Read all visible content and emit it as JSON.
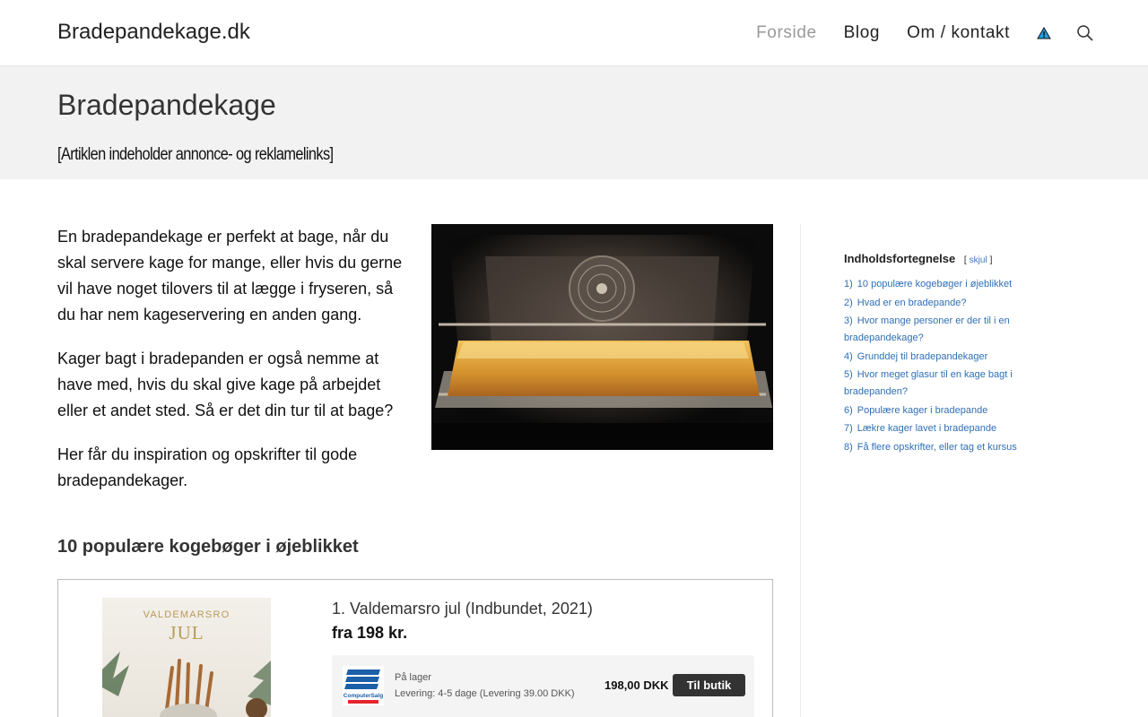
{
  "header": {
    "site_title": "Bradepandekage.dk",
    "nav": [
      {
        "label": "Forside",
        "active": true
      },
      {
        "label": "Blog",
        "active": false
      },
      {
        "label": "Om / kontakt",
        "active": false
      }
    ],
    "flag_icon": "warning-flag-icon",
    "search_icon": "search-icon"
  },
  "title_band": {
    "title": "Bradepandekage",
    "disclaimer": "[Artiklen indeholder annonce- og reklamelinks]"
  },
  "intro": {
    "paragraphs": [
      "En bradepandekage er perfekt at bage, når du skal servere kage for mange, eller hvis du gerne vil have noget tilovers til at lægge i fryseren, så du har nem kageservering en anden gang.",
      "Kager bagt i bradepanden er også nemme at have med, hvis du skal give kage på arbejdet eller et andet sted. Så er det din tur til at bage?",
      "Her får du inspiration og opskrifter til gode bradepandekager."
    ]
  },
  "section": {
    "heading": "10 populære kogebøger i øjeblikket"
  },
  "product": {
    "cover_small": "VALDEMARSRO",
    "cover_big": "JUL",
    "title": "1. Valdemarsro jul (Indbundet, 2021)",
    "price": "fra 198 kr.",
    "offer": {
      "stock": "På lager",
      "delivery": "Levering: 4-5 dage (Levering 39.00 DKK)",
      "price": "198,00 DKK",
      "button": "Til butik",
      "logo_text": "ComputerSalg"
    }
  },
  "toc": {
    "header": "Indholdsfortegnelse",
    "toggle_open": "[",
    "toggle_label": "skjul",
    "toggle_close": "]",
    "items": [
      {
        "num": "1)",
        "label": "10 populære kogebøger i øjeblikket"
      },
      {
        "num": "2)",
        "label": "Hvad er en bradepande?"
      },
      {
        "num": "3)",
        "label": "Hvor mange personer er der til i en bradepandekage?"
      },
      {
        "num": "4)",
        "label": "Grunddej til bradepandekager"
      },
      {
        "num": "5)",
        "label": "Hvor meget glasur til en kage bagt i bradepanden?"
      },
      {
        "num": "6)",
        "label": "Populære kager i bradepande"
      },
      {
        "num": "7)",
        "label": "Lækre kager lavet i bradepande"
      },
      {
        "num": "8)",
        "label": "Få flere opskrifter, eller tag et kursus"
      }
    ]
  }
}
